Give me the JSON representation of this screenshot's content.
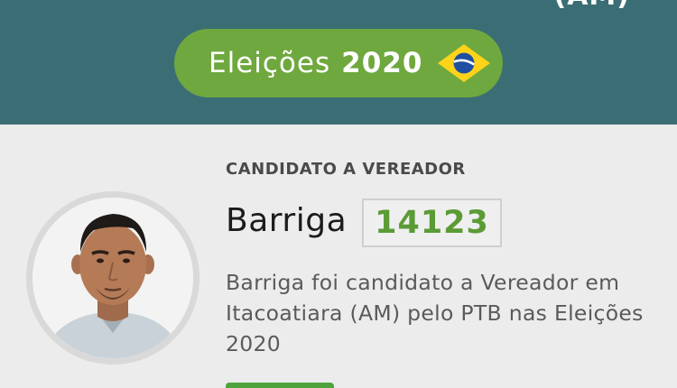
{
  "header": {
    "partial_title": "(AM)",
    "pill_label": "Eleições",
    "pill_year": "2020"
  },
  "candidate": {
    "role": "CANDIDATO A VEREADOR",
    "name": "Barriga",
    "number": "14123",
    "description": "Barriga foi candidato a Vereador em Itacoatiara (AM) pelo PTB nas Eleições 2020"
  },
  "colors": {
    "header_bg": "#3b6e74",
    "pill_bg": "#6fa83e",
    "number_text": "#5b9b35",
    "page_bg": "#ececec"
  },
  "icons": {
    "flag": "brazil-flag-icon",
    "avatar": "candidate-photo"
  }
}
